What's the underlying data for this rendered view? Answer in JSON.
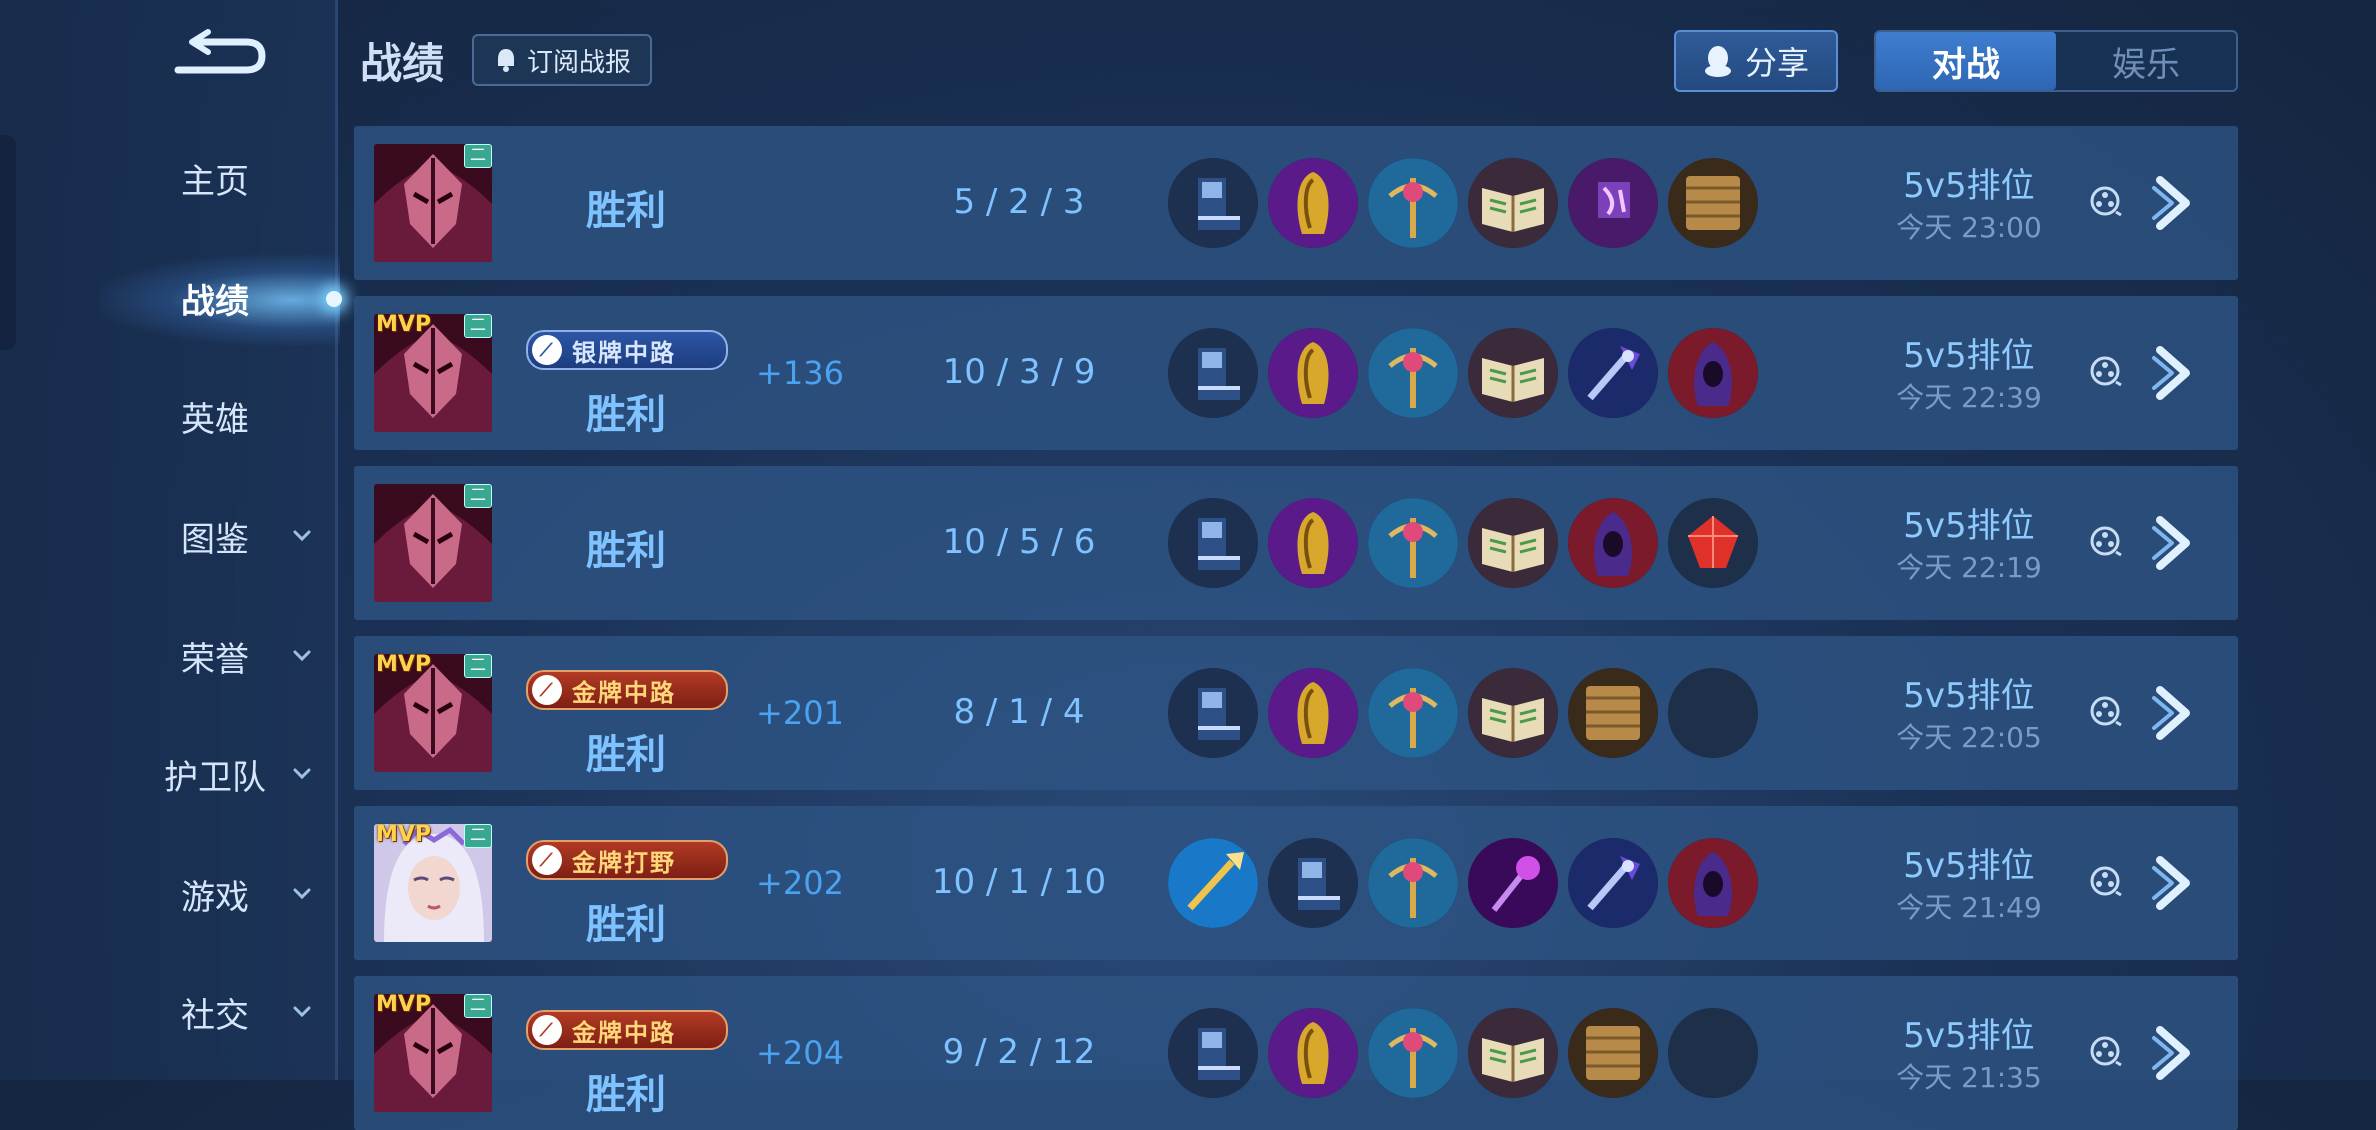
{
  "header": {
    "title": "战绩",
    "subscribe_label": "订阅战报",
    "share_label": "分享",
    "tabs": [
      {
        "label": "对战",
        "active": true
      },
      {
        "label": "娱乐",
        "active": false
      }
    ]
  },
  "sidebar": {
    "items": [
      {
        "label": "主页",
        "active": false,
        "expandable": false
      },
      {
        "label": "战绩",
        "active": true,
        "expandable": false
      },
      {
        "label": "英雄",
        "active": false,
        "expandable": false
      },
      {
        "label": "图鉴",
        "active": false,
        "expandable": true
      },
      {
        "label": "荣誉",
        "active": false,
        "expandable": true
      },
      {
        "label": "护卫队",
        "active": false,
        "expandable": true
      },
      {
        "label": "游戏",
        "active": false,
        "expandable": true
      },
      {
        "label": "社交",
        "active": false,
        "expandable": true
      }
    ]
  },
  "matches": [
    {
      "hero_avatar": "dark-masked-hero",
      "mvp": "",
      "tier_icon": "二",
      "badge": "",
      "badge_style": "",
      "result": "胜利",
      "score": "",
      "kda": "5 / 2 / 3",
      "mode": "5v5排位",
      "time": "今天 23:00",
      "items": [
        "boots-icon",
        "golden-cloak-icon",
        "scepter-icon",
        "spellbook-icon",
        "purple-rune-staff-icon",
        "wooden-shield-icon"
      ]
    },
    {
      "hero_avatar": "dark-masked-hero",
      "mvp": "MVP",
      "tier_icon": "二",
      "badge": "银牌中路",
      "badge_style": "silver",
      "result": "胜利",
      "score": "+136",
      "kda": "10 / 3 / 9",
      "mode": "5v5排位",
      "time": "今天 22:39",
      "items": [
        "boots-icon",
        "golden-cloak-icon",
        "scepter-icon",
        "spellbook-icon",
        "blue-crystal-staff-icon",
        "hooded-mage-icon"
      ]
    },
    {
      "hero_avatar": "dark-masked-hero",
      "mvp": "",
      "tier_icon": "二",
      "badge": "",
      "badge_style": "",
      "result": "胜利",
      "score": "",
      "kda": "10 / 5 / 6",
      "mode": "5v5排位",
      "time": "今天 22:19",
      "items": [
        "boots-icon",
        "golden-cloak-icon",
        "scepter-icon",
        "spellbook-icon",
        "hooded-mage-icon",
        "red-gem-icon"
      ]
    },
    {
      "hero_avatar": "dark-masked-hero",
      "mvp": "MVP",
      "tier_icon": "二",
      "badge": "金牌中路",
      "badge_style": "gold",
      "result": "胜利",
      "score": "+201",
      "kda": "8 / 1 / 4",
      "mode": "5v5排位",
      "time": "今天 22:05",
      "items": [
        "boots-icon",
        "golden-cloak-icon",
        "scepter-icon",
        "spellbook-icon",
        "wooden-shield-icon",
        "empty-slot"
      ]
    },
    {
      "hero_avatar": "silver-haired-heroine",
      "mvp": "MVP",
      "tier_icon": "二",
      "badge": "金牌打野",
      "badge_style": "gold",
      "result": "胜利",
      "score": "+202",
      "kda": "10 / 1 / 10",
      "mode": "5v5排位",
      "time": "今天 21:49",
      "items": [
        "golden-spear-icon",
        "boots-icon",
        "scepter-icon",
        "purple-orb-staff-icon",
        "blue-crystal-staff-icon",
        "hooded-mage-icon"
      ]
    },
    {
      "hero_avatar": "dark-masked-hero",
      "mvp": "MVP",
      "tier_icon": "二",
      "badge": "金牌中路",
      "badge_style": "gold",
      "result": "胜利",
      "score": "+204",
      "kda": "9 / 2 / 12",
      "mode": "5v5排位",
      "time": "今天 21:35",
      "items": [
        "boots-icon",
        "golden-cloak-icon",
        "scepter-icon",
        "spellbook-icon",
        "wooden-shield-icon",
        "empty-slot"
      ]
    }
  ],
  "colors": {
    "background": "#1b3257",
    "row": "#2e5484",
    "result_text": "#7ec2ff",
    "score_text": "#4aa2f0",
    "gold_badge": "#b23a24",
    "silver_badge": "#2c56a6",
    "mvp": "#ffd24d"
  }
}
